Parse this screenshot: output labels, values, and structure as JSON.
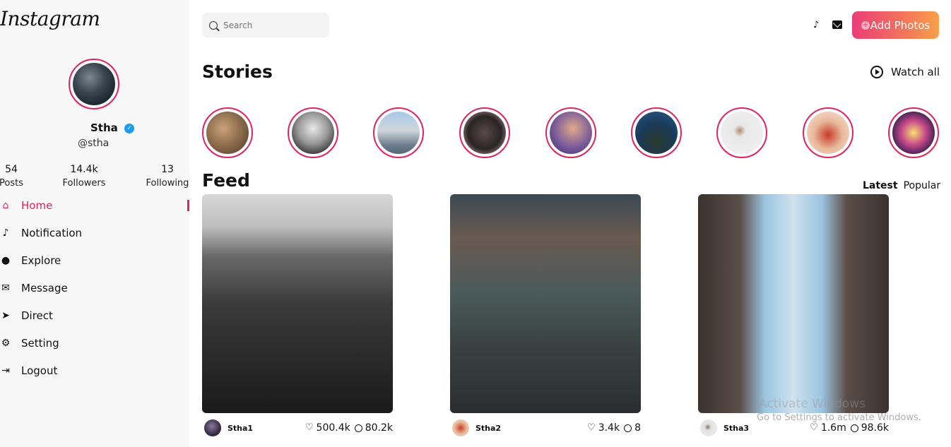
{
  "app": {
    "logo_text": "Instagram"
  },
  "profile": {
    "name": "Stha",
    "handle": "@stha",
    "stats": [
      {
        "value": "54",
        "label": "Posts"
      },
      {
        "value": "14.4k",
        "label": "Followers"
      },
      {
        "value": "13",
        "label": "Following"
      }
    ]
  },
  "nav": {
    "items": [
      {
        "label": "Home",
        "icon": "home-icon",
        "active": true
      },
      {
        "label": "Notification",
        "icon": "bell-icon"
      },
      {
        "label": "Explore",
        "icon": "compass-icon"
      },
      {
        "label": "Message",
        "icon": "mail-icon"
      },
      {
        "label": "Direct",
        "icon": "send-icon"
      },
      {
        "label": "Setting",
        "icon": "gear-icon"
      },
      {
        "label": "Logout",
        "icon": "logout-icon"
      }
    ]
  },
  "topbar": {
    "search_placeholder": "Search",
    "add_photos_label": "Add Photos"
  },
  "stories": {
    "title": "Stories",
    "watch_all_label": "Watch all",
    "count": 9
  },
  "feed": {
    "title": "Feed",
    "tabs": [
      "Latest",
      "Popular"
    ],
    "active_tab": "Latest",
    "posts": [
      {
        "user": "Stha1",
        "likes": "500.4k",
        "comments": "80.2k"
      },
      {
        "user": "Stha2",
        "likes": "3.4k",
        "comments": "8"
      },
      {
        "user": "Stha3",
        "likes": "1.6m",
        "comments": "98.6k"
      }
    ]
  },
  "watermark": {
    "title": "Activate Windows",
    "subtitle": "Go to Settings to activate Windows."
  },
  "colors": {
    "accent": "#e0245e",
    "button_gradient_start": "#ea3d78",
    "button_gradient_end": "#f8a048",
    "verified": "#1d9bf0"
  }
}
